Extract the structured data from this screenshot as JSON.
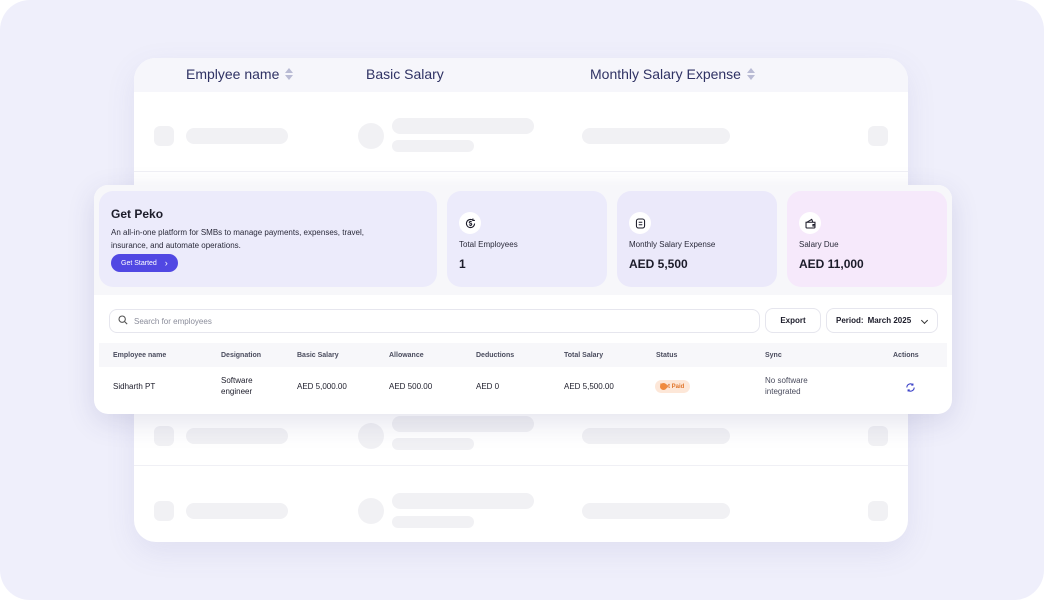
{
  "background_table": {
    "columns": [
      {
        "label": "Emplyee name",
        "sortable": true
      },
      {
        "label": "Basic Salary",
        "sortable": false
      },
      {
        "label": "Monthly Salary Expense",
        "sortable": true
      }
    ]
  },
  "promo": {
    "title": "Get Peko",
    "text": "An all-in-one platform for SMBs to manage payments, expenses, travel, insurance, and automate operations.",
    "button_label": "Get Started"
  },
  "stats": [
    {
      "icon": "dollar-refresh-icon",
      "label": "Total Employees",
      "value": "1",
      "color": "#ecebfb"
    },
    {
      "icon": "document-list-icon",
      "label": "Monthly Salary Expense",
      "value": "AED 5,500",
      "color": "#ebe9fa"
    },
    {
      "icon": "wallet-icon",
      "label": "Salary Due",
      "value": "AED 11,000",
      "color": "#f6e9fb"
    }
  ],
  "toolbar": {
    "search_placeholder": "Search for employees",
    "export_label": "Export",
    "period_label": "Period:",
    "period_value": "March 2025"
  },
  "table": {
    "headers": [
      "Employee name",
      "Designation",
      "Basic Salary",
      "Allowance",
      "Deductions",
      "Total Salary",
      "Status",
      "Sync",
      "Actions"
    ],
    "rows": [
      {
        "employee_name": "Sidharth PT",
        "designation": [
          "Software",
          "engineer"
        ],
        "basic_salary": "AED 5,000.00",
        "allowance": "AED 500.00",
        "deductions": "AED 0",
        "total_salary": "AED 5,500.00",
        "status": "Not Paid",
        "sync": [
          "No software",
          "integrated"
        ],
        "action_icon": "sync-icon"
      }
    ]
  },
  "colors": {
    "accent": "#5148e3",
    "status_not_paid_bg": "#fde7d8",
    "status_not_paid_text": "#e0762d",
    "canvas": "#efeffb"
  }
}
